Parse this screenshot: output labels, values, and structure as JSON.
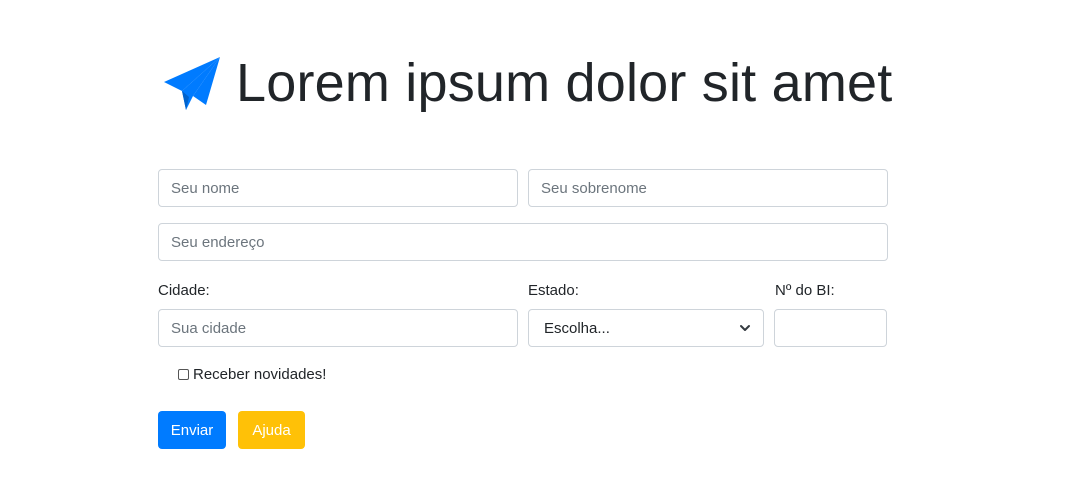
{
  "header": {
    "icon": "paper-plane-icon",
    "title": "Lorem ipsum dolor sit amet"
  },
  "form": {
    "first_name": {
      "placeholder": "Seu nome",
      "value": ""
    },
    "last_name": {
      "placeholder": "Seu sobrenome",
      "value": ""
    },
    "address": {
      "placeholder": "Seu endereço",
      "value": ""
    },
    "city": {
      "label": "Cidade:",
      "placeholder": "Sua cidade",
      "value": ""
    },
    "state": {
      "label": "Estado:",
      "selected": "Escolha..."
    },
    "bi_number": {
      "label": "Nº do BI:",
      "value": ""
    },
    "newsletter": {
      "label": "Receber novidades!",
      "checked": false
    },
    "submit_label": "Enviar",
    "help_label": "Ajuda"
  },
  "colors": {
    "accent": "#007bff",
    "warning": "#ffc107",
    "border": "#ced4da",
    "text": "#212529"
  }
}
